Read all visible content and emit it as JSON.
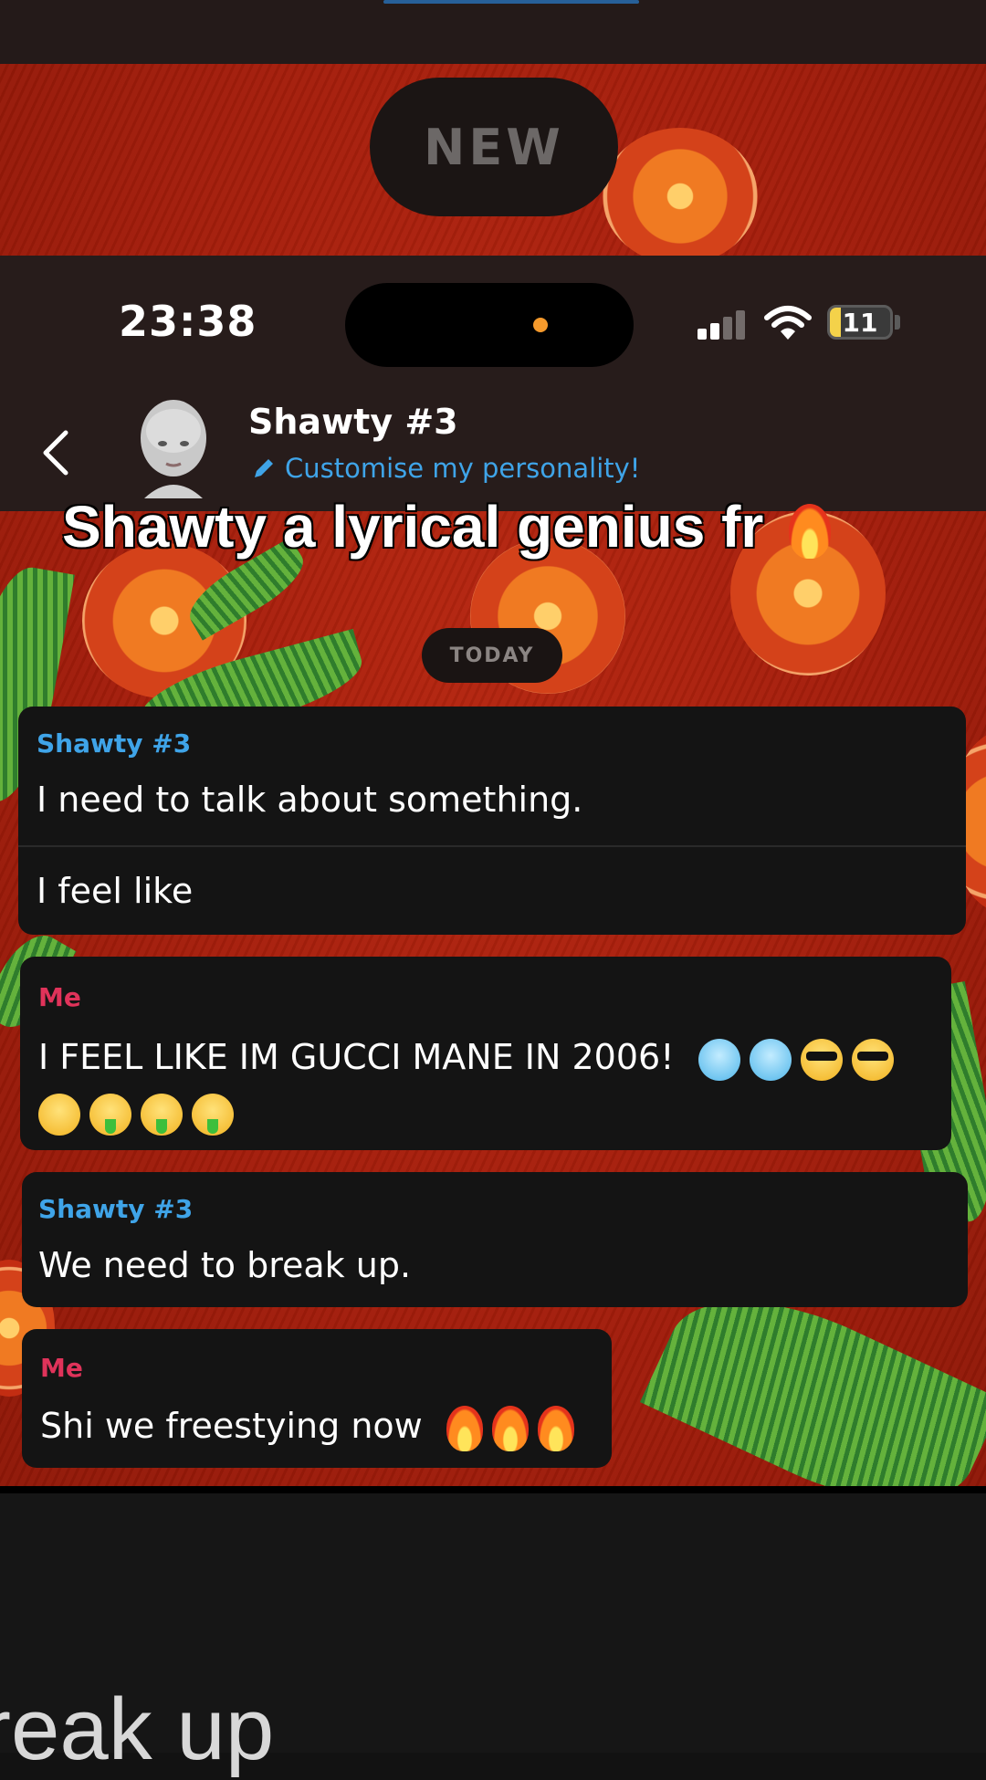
{
  "previous_frame": {
    "new_label": "NEW"
  },
  "status_bar": {
    "time": "23:38",
    "battery": "11"
  },
  "header": {
    "contact_name": "Shawty #3",
    "customise_link": "Customise my personality!"
  },
  "overlay_caption": "Shawty a lyrical genius fr",
  "date_divider": "TODAY",
  "messages": [
    {
      "sender": "Shawty #3",
      "lines": [
        "I need to talk about something.",
        "I feel like"
      ]
    },
    {
      "sender": "Me",
      "text": "I FEEL LIKE IM GUCCI MANE IN 2006!",
      "emojis": [
        "cold-face",
        "cold-face",
        "sunglasses-face",
        "sunglasses-face",
        "huffing-face",
        "money-mouth-face",
        "money-mouth-face",
        "money-mouth-face"
      ]
    },
    {
      "sender": "Shawty #3",
      "text": "We need to break up."
    },
    {
      "sender": "Me",
      "text": "Shi we freestying now",
      "emojis": [
        "fire",
        "fire",
        "fire"
      ]
    }
  ],
  "bottom_caption": "reak up",
  "colors": {
    "them_name": "#3fa4e8",
    "me_name": "#e0335a",
    "background": "#a31d0b",
    "bubble": "#141414"
  }
}
